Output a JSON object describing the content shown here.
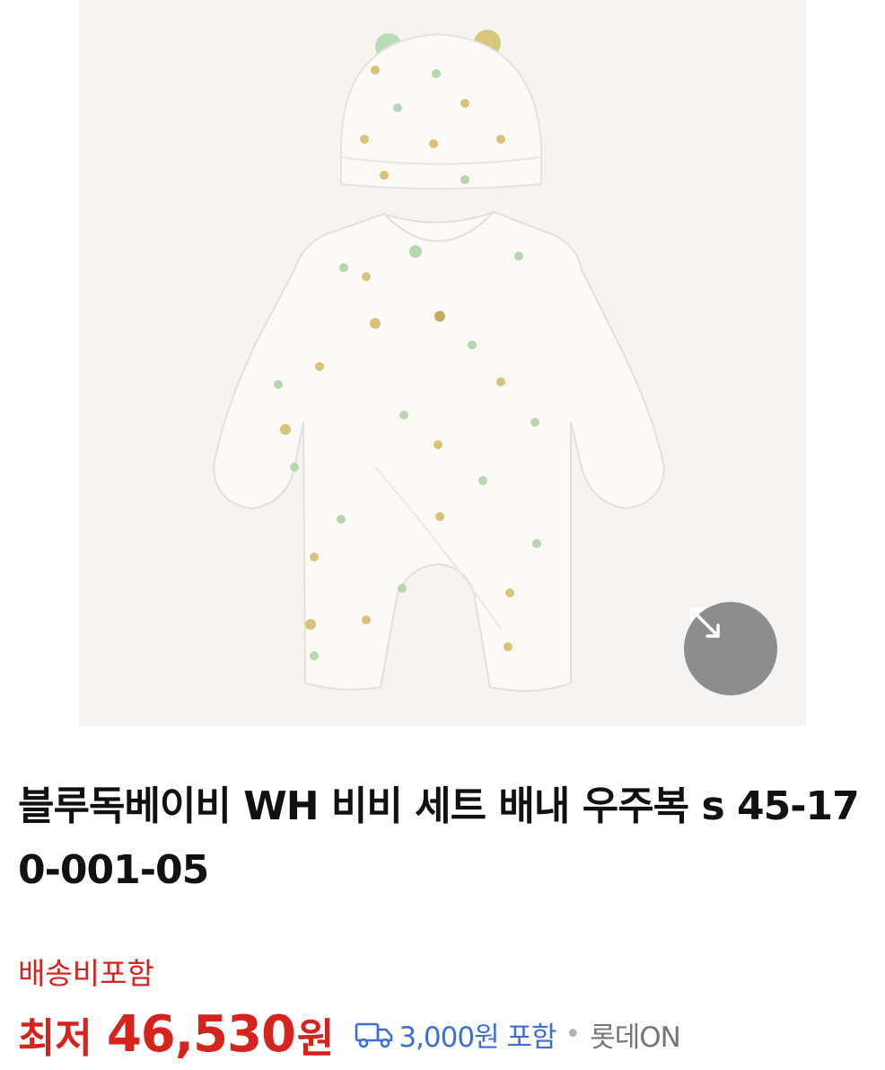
{
  "product": {
    "title": "블루독베이비 WH 비비 세트 배내 우주복 s 45-170-001-05",
    "shipping_note": "배송비포함",
    "price_prefix": "최저",
    "price_value": "46,530",
    "price_unit": "원",
    "shipping_fee": "3,000원 포함",
    "separator": "•",
    "seller": "롯데ON"
  },
  "image": {
    "description_icons": [
      "expand-icon",
      "truck-icon"
    ],
    "background_color": "#f5f4f2"
  },
  "colors": {
    "price_red": "#d6231e",
    "link_blue": "#3e6fd6",
    "zoom_button_gray": "#8d8d8d"
  }
}
